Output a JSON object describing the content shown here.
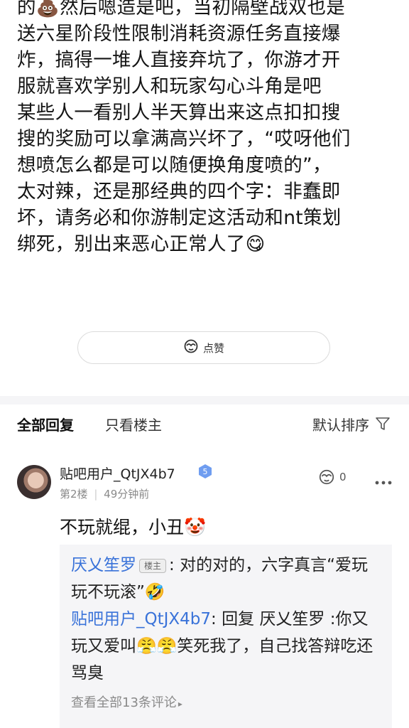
{
  "post": {
    "lines": [
      "的💩然后嗯造是吧，当初隔壁战双也是",
      "送六星阶段性限制消耗资源任务直接爆",
      "炸，搞得一堆人直接弃坑了，你游才开",
      "服就喜欢学别人和玩家勾心斗角是吧",
      "某些人一看别人半天算出来这点扣扣搜",
      "搜的奖励可以拿满高兴坏了，“哎呀他们",
      "想喷怎么都是可以随便换角度喷的”，",
      "太对辣，还是那经典的四个字：非蠢即",
      "坏，请务必和你游制定这活动和nt策划",
      "绑死，别出来恶心正常人了😋"
    ],
    "like_label": "点赞"
  },
  "tabs": {
    "all": "全部回复",
    "op_only": "只看楼主",
    "sort": "默认排序"
  },
  "reply": {
    "username": "贴吧用户_QtJX4b7",
    "level": "5",
    "floor": "第2楼",
    "time": "49分钟前",
    "like_count": "0",
    "content": "不玩就绲，小丑🤡",
    "sub_replies": [
      {
        "author": "厌乂笙罗",
        "badge": "楼主",
        "text": ": 对的对的，六字真言“爱玩玩不玩滚”🤣"
      },
      {
        "author": "贴吧用户_QtJX4b7",
        "text": ": 回复 厌乂笙罗 :你又玩又爱叫😤😤笑死我了，自己找答辩吃还骂臭"
      }
    ],
    "view_all": "查看全部13条评论"
  }
}
